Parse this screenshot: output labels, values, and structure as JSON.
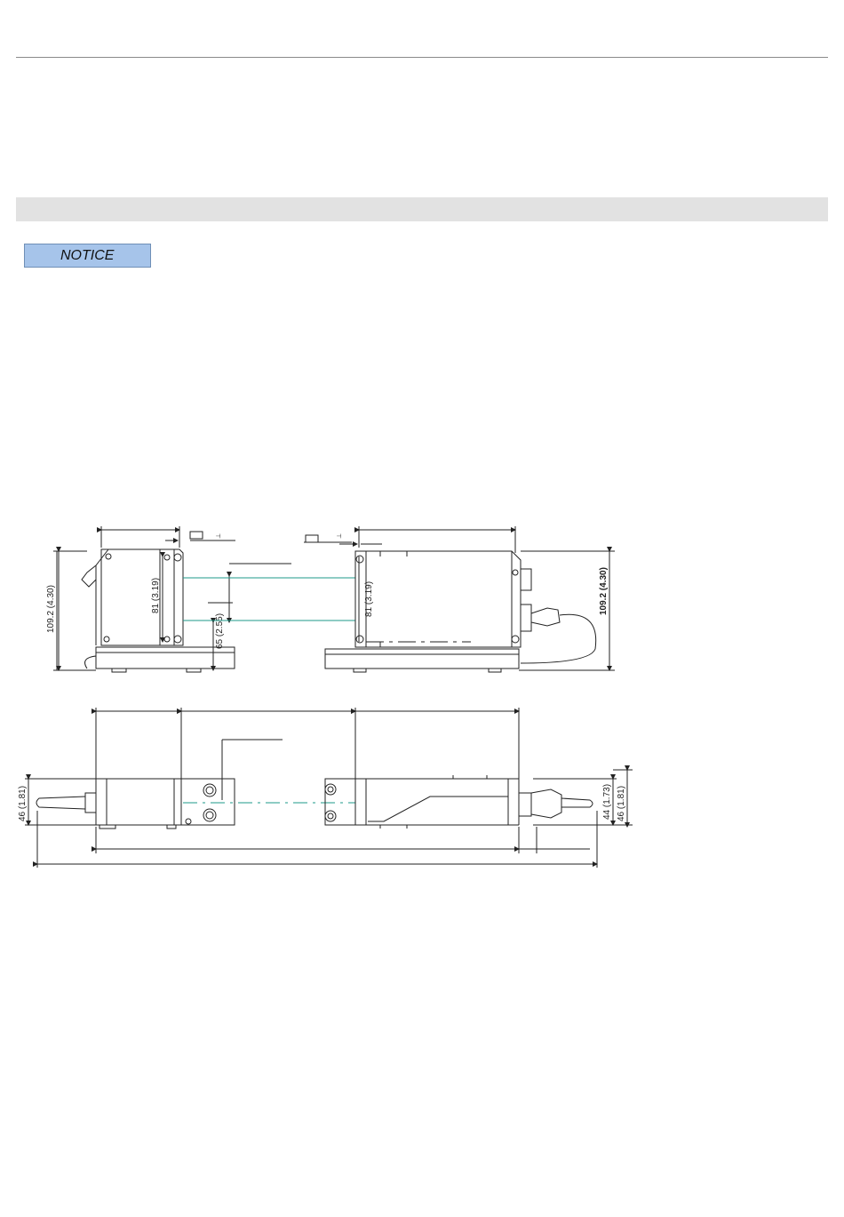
{
  "notice": {
    "label": "NOTICE"
  },
  "drawing": {
    "dims": {
      "left_height": "109.2 (4.30)",
      "left_inner": "81 (3.19)",
      "left_offset": "65 (2.55)",
      "right_inner": "81 (3.19)",
      "right_height": "109.2 (4.30)",
      "bottom_left_height": "46 (1.81)",
      "bottom_right_inner": "44 (1.73)",
      "bottom_right_height": "46 (1.81)"
    },
    "colors": {
      "beam": "#1e9a8a",
      "line": "#222222"
    }
  }
}
